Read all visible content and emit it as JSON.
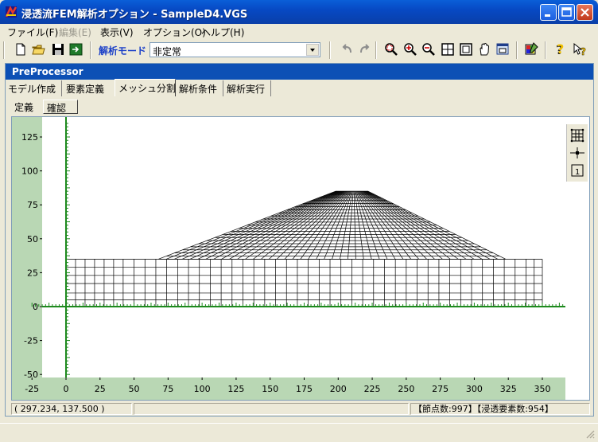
{
  "window": {
    "title": "浸透流FEM解析オプション - SampleD4.VGS",
    "icons": [
      "app-icon",
      "minimize-icon",
      "maximize-icon",
      "close-icon"
    ]
  },
  "menu": [
    {
      "label": "ファイル(F)",
      "enabled": true
    },
    {
      "label": "編集(E)",
      "enabled": false
    },
    {
      "label": "表示(V)",
      "enabled": true
    },
    {
      "label": "オプション(O)",
      "enabled": true
    },
    {
      "label": "ヘルプ(H)",
      "enabled": true
    }
  ],
  "toolbar": {
    "mode_label": "解析モード",
    "mode_value": "非定常",
    "icons": [
      "new-file-icon",
      "open-folder-icon",
      "save-icon",
      "export-icon",
      "undo-icon",
      "redo-icon",
      "zoom-region-icon",
      "zoom-in-icon",
      "zoom-out-icon",
      "fit-all-icon",
      "fit-window-icon",
      "pan-hand-icon",
      "print-preview-icon",
      "color-settings-icon",
      "help-icon",
      "context-help-icon"
    ]
  },
  "panel": {
    "title": "PreProcessor",
    "tabs": [
      "モデル作成",
      "要素定義",
      "メッシュ分割",
      "解析条件",
      "解析実行"
    ],
    "active_tab": "メッシュ分割",
    "subtabs": [
      "定義",
      "確認"
    ],
    "active_subtab": "確認",
    "side_icons": [
      "mesh-grid-icon",
      "node-icon",
      "element-number-icon"
    ]
  },
  "plot": {
    "x_ticks": [
      "-25",
      "0",
      "25",
      "50",
      "75",
      "100",
      "125",
      "150",
      "175",
      "200",
      "225",
      "250",
      "275",
      "300",
      "325",
      "350"
    ],
    "y_ticks": [
      "125",
      "100",
      "75",
      "50",
      "25",
      "0",
      "-25",
      "-50"
    ],
    "xlim": [
      -27,
      365
    ],
    "ylim": [
      -53,
      137
    ],
    "colors": {
      "axis_band": "#b9d7b4",
      "axis_line": "#1e8a1e",
      "mesh": "#000000"
    }
  },
  "status": {
    "coords": "( 297.234,  137.500 )",
    "counts": "【節点数:997】【浸透要素数:954】"
  }
}
